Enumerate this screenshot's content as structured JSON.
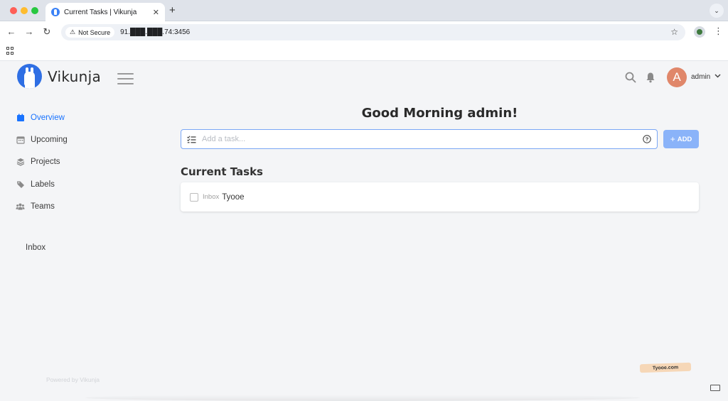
{
  "browser": {
    "tab_title": "Current Tasks | Vikunja",
    "new_tab_label": "+",
    "security_label": "Not Secure",
    "url": "91.███.███.74:3456"
  },
  "app": {
    "brand": "Vikunja",
    "user": {
      "initial": "A",
      "name": "admin"
    },
    "accent_color": "#1973ff"
  },
  "sidebar": {
    "items": [
      {
        "label": "Overview",
        "icon": "calendar-icon",
        "active": true
      },
      {
        "label": "Upcoming",
        "icon": "calendar-grid-icon",
        "active": false
      },
      {
        "label": "Projects",
        "icon": "layers-icon",
        "active": false
      },
      {
        "label": "Labels",
        "icon": "tags-icon",
        "active": false
      },
      {
        "label": "Teams",
        "icon": "users-icon",
        "active": false
      }
    ],
    "projects": [
      {
        "label": "Inbox"
      }
    ],
    "footer": "Powered by Vikunja"
  },
  "main": {
    "greeting": "Good Morning admin!",
    "task_input": {
      "placeholder": "Add a task..."
    },
    "add_button": "ADD",
    "section_title": "Current Tasks",
    "tasks": [
      {
        "project": "Inbox",
        "title": "Tyooe",
        "done": false
      }
    ]
  },
  "watermark": "Tyooe.com"
}
